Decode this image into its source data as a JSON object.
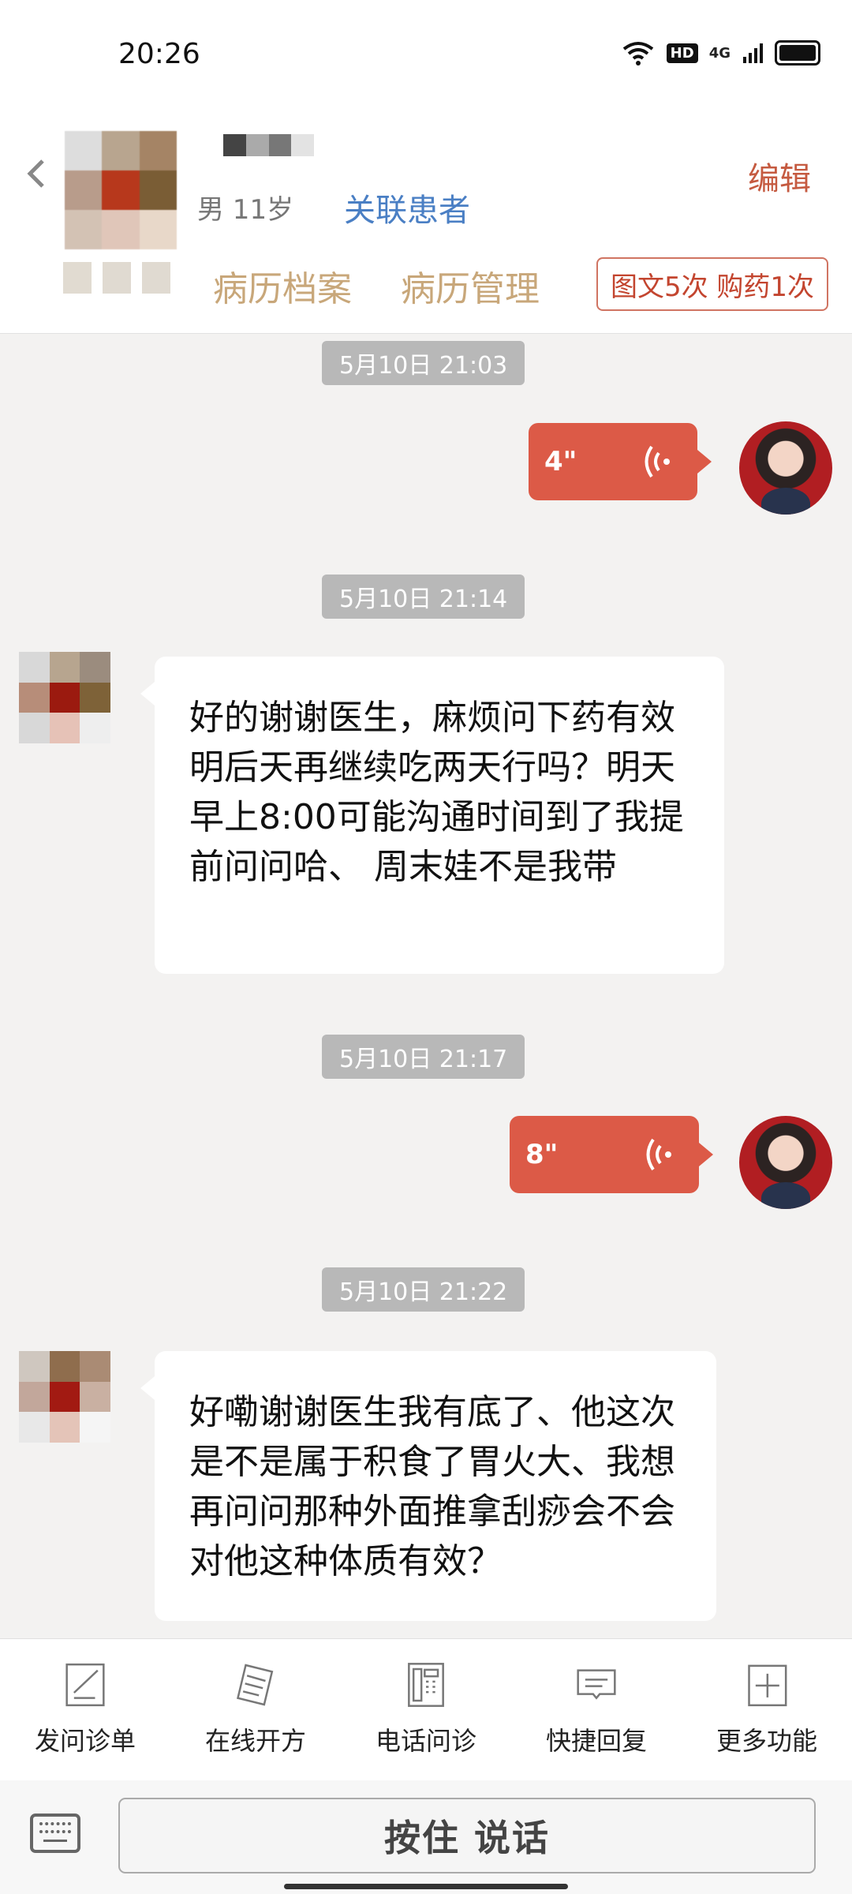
{
  "status_bar": {
    "time": "20:26",
    "hd": "HD",
    "network": "4G"
  },
  "header": {
    "gender_age": "男 11岁",
    "link_patient": "关联患者",
    "edit": "编辑",
    "tabs": [
      "病历档案",
      "病历管理"
    ],
    "quota": "图文5次 购药1次"
  },
  "colors": {
    "accent": "#dc5a47",
    "link": "#4a7fc4",
    "tab": "#c8a77a"
  },
  "chat": [
    {
      "timestamp": "5月10日 21:03",
      "type": "voice",
      "from": "doctor",
      "duration": "4\""
    },
    {
      "timestamp": "5月10日 21:14",
      "type": "text",
      "from": "patient",
      "text": "好的谢谢医生，麻烦问下药有效明后天再继续吃两天行吗？明天早上8:00可能沟通时间到了我提前问问哈、 周末娃不是我带"
    },
    {
      "timestamp": "5月10日 21:17",
      "type": "voice",
      "from": "doctor",
      "duration": "8\""
    },
    {
      "timestamp": "5月10日 21:22",
      "type": "text",
      "from": "patient",
      "text": "好嘞谢谢医生我有底了、他这次是不是属于积食了胃火大、我想再问问那种外面推拿刮痧会不会对他这种体质有效？"
    }
  ],
  "toolbar": [
    {
      "label": "发问诊单",
      "icon": "form-edit-icon"
    },
    {
      "label": "在线开方",
      "icon": "prescription-icon"
    },
    {
      "label": "电话问诊",
      "icon": "phone-icon"
    },
    {
      "label": "快捷回复",
      "icon": "message-icon"
    },
    {
      "label": "更多功能",
      "icon": "plus-square-icon"
    }
  ],
  "input": {
    "talk": "按住 说话"
  }
}
